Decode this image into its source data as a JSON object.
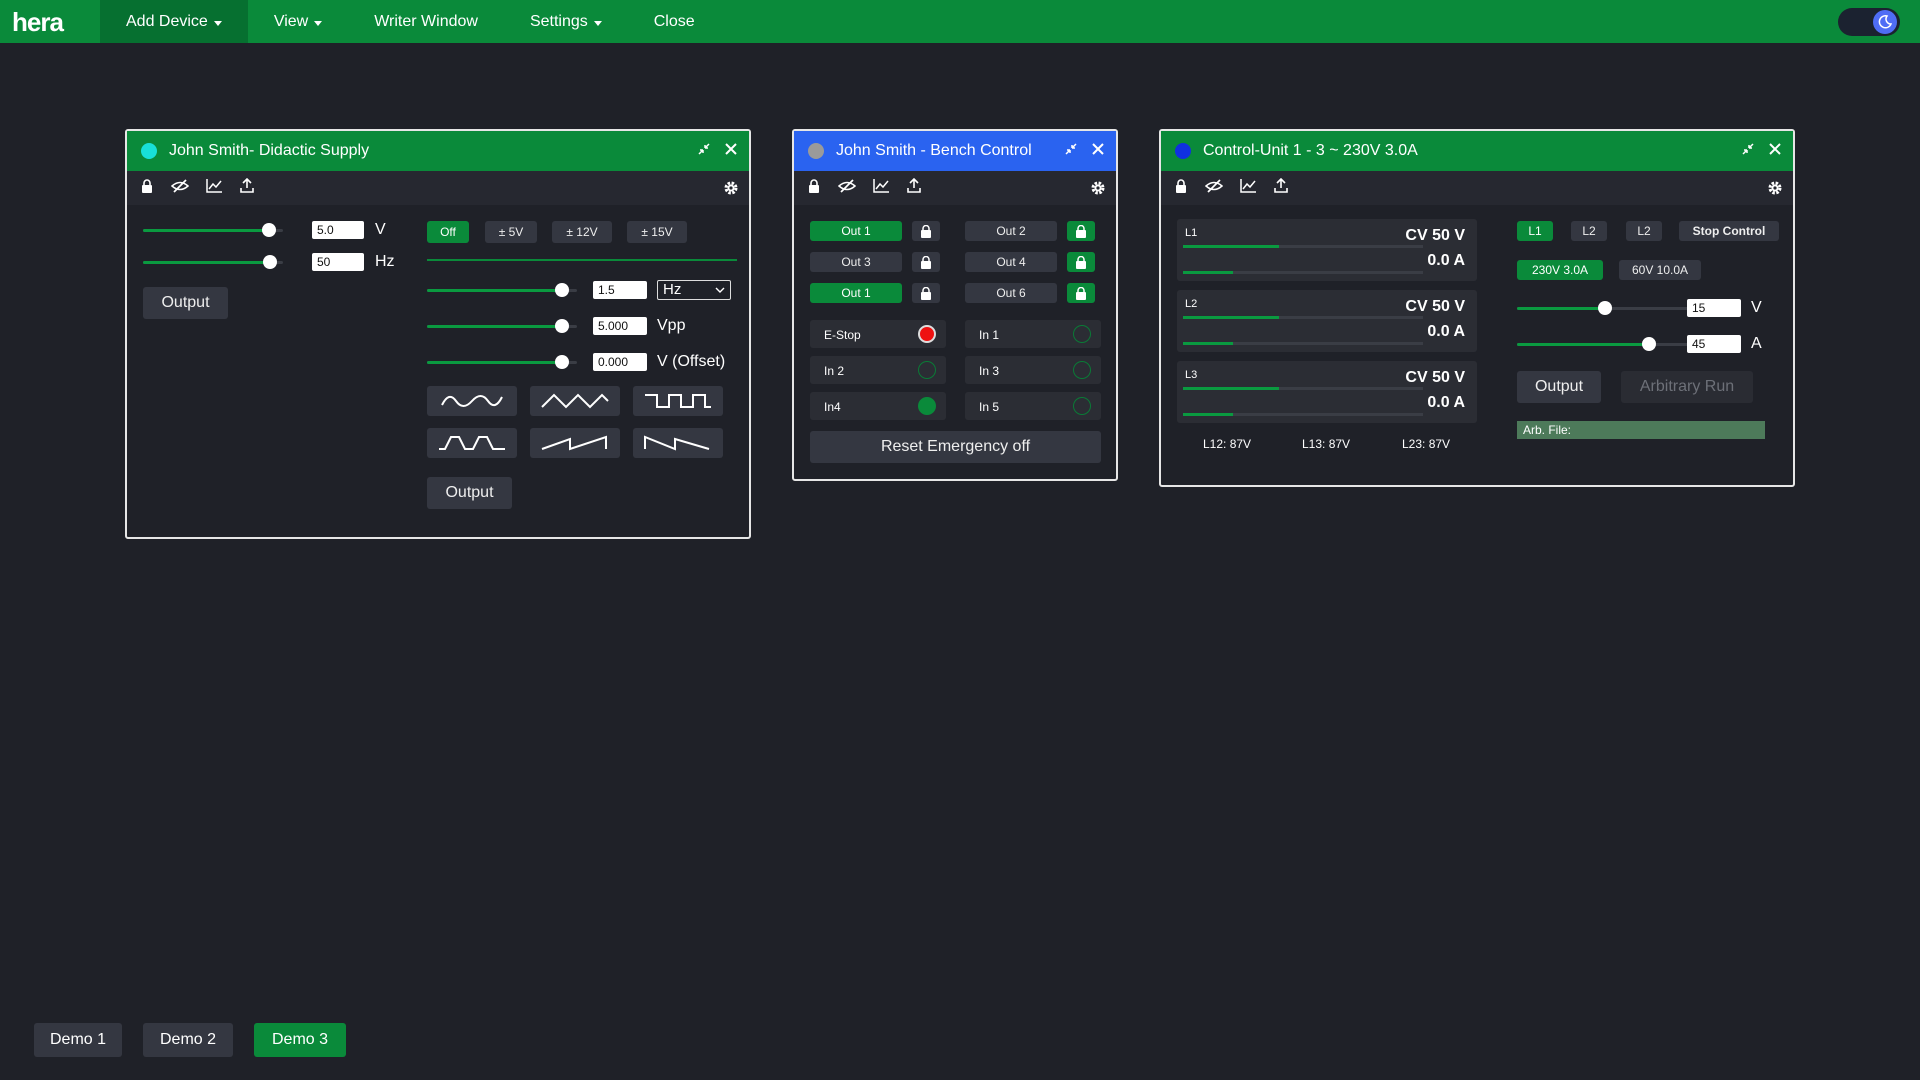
{
  "nav": {
    "logo": "hera",
    "items": [
      "Add Device",
      "View",
      "Writer Window",
      "Settings",
      "Close"
    ]
  },
  "colors": {
    "brand": "#0a8a3a",
    "blue_header": "#2a63f0",
    "background": "#1f2128"
  },
  "panel1": {
    "title": "John Smith- Didactic Supply",
    "status_color": "#18e0d8",
    "v_value": "5.0",
    "v_unit": "V",
    "hz_value": "50",
    "hz_unit": "Hz",
    "output_label": "Output",
    "range_buttons": [
      "Off",
      "± 5V",
      "± 12V",
      "± 15V"
    ],
    "freq_value": "1.5",
    "freq_unit_select": "Hz",
    "vpp_value": "5.000",
    "vpp_unit": "Vpp",
    "offset_value": "0.000",
    "offset_unit": "V (Offset)",
    "gen_output_label": "Output",
    "waveforms": [
      "sine-wave",
      "triangle-wave",
      "square-wave",
      "trapezoid-wave",
      "sawtooth-wave",
      "reverse-sawtooth-wave"
    ],
    "slider_levels": {
      "v": 0.9,
      "hz": 0.91,
      "freq": 0.9,
      "vpp": 0.9,
      "offset": 0.9
    }
  },
  "panel2": {
    "title": "John Smith - Bench Control",
    "status_color": "#9a9a9a",
    "outputs": [
      {
        "label": "Out 1",
        "active": true
      },
      {
        "label": "Out 2",
        "active": false
      },
      {
        "label": "Out 3",
        "active": false
      },
      {
        "label": "Out 4",
        "active": false
      },
      {
        "label": "Out 1",
        "active": true
      },
      {
        "label": "Out 6",
        "active": false
      }
    ],
    "inputs": [
      "E-Stop",
      "In 1",
      "In 2",
      "In 3",
      "In4",
      "In 5"
    ],
    "reset_label": "Reset Emergency off"
  },
  "panel3": {
    "title": "Control-Unit 1 - 3 ~ 230V 3.0A",
    "status_color": "#1030e0",
    "lines": [
      {
        "name": "L1",
        "cv": "CV 50 V",
        "amp": "0.0 A"
      },
      {
        "name": "L2",
        "cv": "CV 50 V",
        "amp": "0.0 A"
      },
      {
        "name": "L3",
        "cv": "CV 50 V",
        "amp": "0.0 A"
      }
    ],
    "line_voltages": [
      "L12: 87V",
      "L13: 87V",
      "L23: 87V"
    ],
    "phase_buttons": [
      "L1",
      "L2",
      "L2"
    ],
    "stop_label": "Stop Control",
    "mode_buttons": [
      "230V 3.0A",
      "60V 10.0A"
    ],
    "v_value": "15",
    "v_unit": "V",
    "a_value": "45",
    "a_unit": "A",
    "output_label": "Output",
    "arb_run_label": "Arbitrary Run",
    "arb_file_label": "Arb. File:",
    "slider_levels": {
      "v": 0.5,
      "a": 0.75
    }
  },
  "demos": [
    "Demo 1",
    "Demo 2",
    "Demo 3"
  ]
}
